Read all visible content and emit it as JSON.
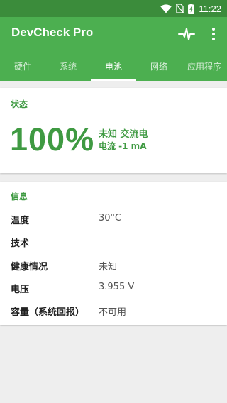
{
  "status_bar": {
    "time": "11:22"
  },
  "app_bar": {
    "title": "DevCheck Pro",
    "pulse_icon": "pulse-waveform-icon",
    "more_icon": "more-vertical-icon"
  },
  "tabs": [
    {
      "label": "硬件",
      "active": false
    },
    {
      "label": "系统",
      "active": false
    },
    {
      "label": "电池",
      "active": true
    },
    {
      "label": "网络",
      "active": false
    },
    {
      "label": "应用程序",
      "active": false
    }
  ],
  "status_section": {
    "title": "状态",
    "percent": "100%",
    "line1": "未知 交流电",
    "line2": "电流 -1 mA"
  },
  "info_section": {
    "title": "信息",
    "rows": [
      {
        "label": "温度",
        "value": "30°C"
      },
      {
        "label": "技术",
        "value": ""
      },
      {
        "label": "健康情况",
        "value": "未知"
      },
      {
        "label": "电压",
        "value": "3.955 V"
      },
      {
        "label": "容量（系统回报）",
        "value": "不可用"
      }
    ]
  },
  "colors": {
    "primary": "#4caf50",
    "primary_dark": "#3b8c3b",
    "accent_text": "#3f9a42"
  }
}
